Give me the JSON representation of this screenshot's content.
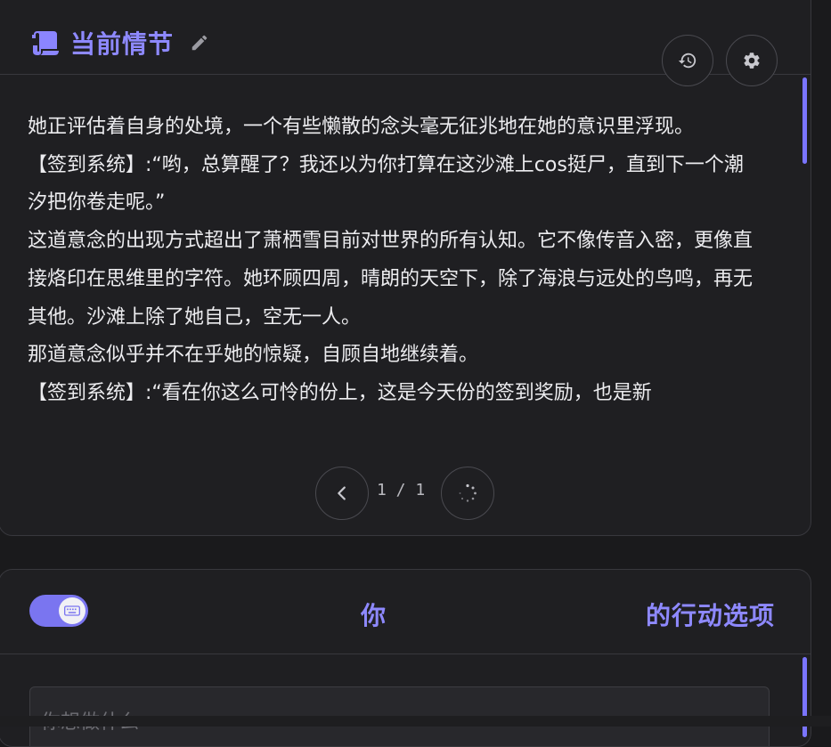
{
  "story": {
    "title": "当前情节",
    "paragraphs": [
      "她正评估着自身的处境，一个有些懒散的念头毫无征兆地在她的意识里浮现。",
      "【签到系统】:“哟，总算醒了？我还以为你打算在这沙滩上cos挺尸，直到下一个潮汐把你卷走呢。”",
      "这道意念的出现方式超出了萧栖雪目前对世界的所有认知。它不像传音入密，更像直接烙印在思维里的字符。她环顾四周，晴朗的天空下，除了海浪与远处的鸟鸣，再无其他。沙滩上除了她自己，空无一人。",
      "那道意念似乎并不在乎她的惊疑，自顾自地继续着。",
      "【签到系统】:“看在你这么可怜的份上，这是今天份的签到奖励，也是新"
    ],
    "pager": "1 / 1",
    "icons": {
      "title": "scroll-icon",
      "edit": "pencil-icon",
      "history": "history-icon",
      "settings": "gear-icon",
      "prev": "chevron-left-icon",
      "reload": "spinner-icon"
    }
  },
  "actions": {
    "title_left": "你",
    "title_right": "的行动选项",
    "input_placeholder": "你想做什么",
    "toggle_on": true,
    "icons": {
      "toggle": "keyboard-icon"
    }
  },
  "colors": {
    "accent": "#8e89ff",
    "panel_bg": "#1f1f22",
    "border": "#38383d"
  }
}
